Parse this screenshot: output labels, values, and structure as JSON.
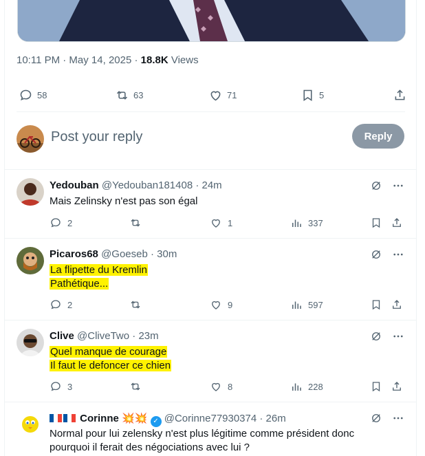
{
  "post": {
    "time": "10:11 PM · May 14, 2025 · ",
    "views_count": "18.8K",
    "views_label": " Views",
    "actions": {
      "replies": "58",
      "reposts": "63",
      "likes": "71",
      "bookmarks": "5"
    }
  },
  "reply_box": {
    "placeholder": "Post your reply",
    "button": "Reply"
  },
  "replies": [
    {
      "name": "Yedouban",
      "handle": "@Yedouban181408 · 24m",
      "lines": [
        "Mais Zelinsky n'est pas son égal"
      ],
      "highlight": false,
      "stats": {
        "replies": "2",
        "reposts": "",
        "likes": "1",
        "views": "337"
      }
    },
    {
      "name": "Picaros68",
      "handle": "@Goeseb · 30m",
      "lines": [
        "La flipette du Kremlin",
        "Pathétique..."
      ],
      "highlight": true,
      "stats": {
        "replies": "2",
        "reposts": "",
        "likes": "9",
        "views": "597"
      }
    },
    {
      "name": "Clive",
      "handle": "@CliveTwo · 23m",
      "lines": [
        "Quel manque de courage",
        "Il faut le defoncer ce chien"
      ],
      "highlight": true,
      "stats": {
        "replies": "3",
        "reposts": "",
        "likes": "8",
        "views": "228"
      }
    },
    {
      "name": "Corinne",
      "handle": "@Corinne77930374 · 26m",
      "lines": [
        "Normal pour lui zelensky n'est plus légitime comme président donc",
        "pourquoi il ferait des négociations avec lui ?"
      ],
      "highlight": false
    }
  ],
  "colors": {
    "text": "#0f1419",
    "secondary": "#536471",
    "highlight": "#fff200",
    "reply_button": "#8b98a5",
    "verified": "#1d9bf0"
  }
}
